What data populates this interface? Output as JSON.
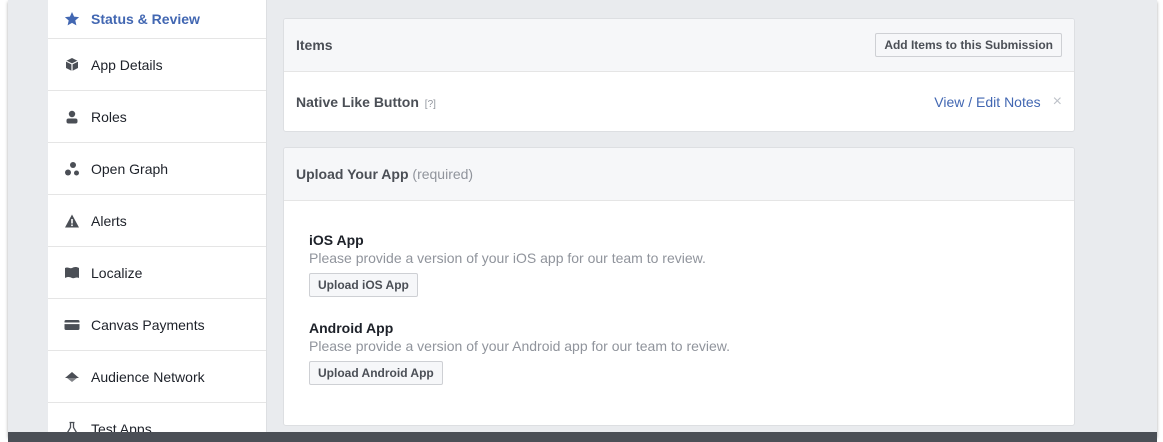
{
  "sidebar": {
    "items": [
      {
        "label": "Status & Review",
        "icon": "star-icon"
      },
      {
        "label": "App Details",
        "icon": "cube-icon"
      },
      {
        "label": "Roles",
        "icon": "person-icon"
      },
      {
        "label": "Open Graph",
        "icon": "graph-icon"
      },
      {
        "label": "Alerts",
        "icon": "warning-icon"
      },
      {
        "label": "Localize",
        "icon": "flag-icon"
      },
      {
        "label": "Canvas Payments",
        "icon": "card-icon"
      },
      {
        "label": "Audience Network",
        "icon": "megaphone-icon"
      },
      {
        "label": "Test Apps",
        "icon": "flask-icon"
      }
    ]
  },
  "items_panel": {
    "title": "Items",
    "add_button": "Add Items to this Submission",
    "rows": [
      {
        "label": "Native Like Button",
        "help": "[?]",
        "link": "View / Edit Notes",
        "close": "×"
      }
    ]
  },
  "upload_panel": {
    "title": "Upload Your App",
    "title_note": "(required)",
    "apps": [
      {
        "title": "iOS App",
        "desc": "Please provide a version of your iOS app for our team to review.",
        "button": "Upload iOS App"
      },
      {
        "title": "Android App",
        "desc": "Please provide a version of your Android app for our team to review.",
        "button": "Upload Android App"
      }
    ]
  },
  "colors": {
    "accent": "#4267b2",
    "background": "#e9ebee",
    "muted": "#90949c"
  }
}
